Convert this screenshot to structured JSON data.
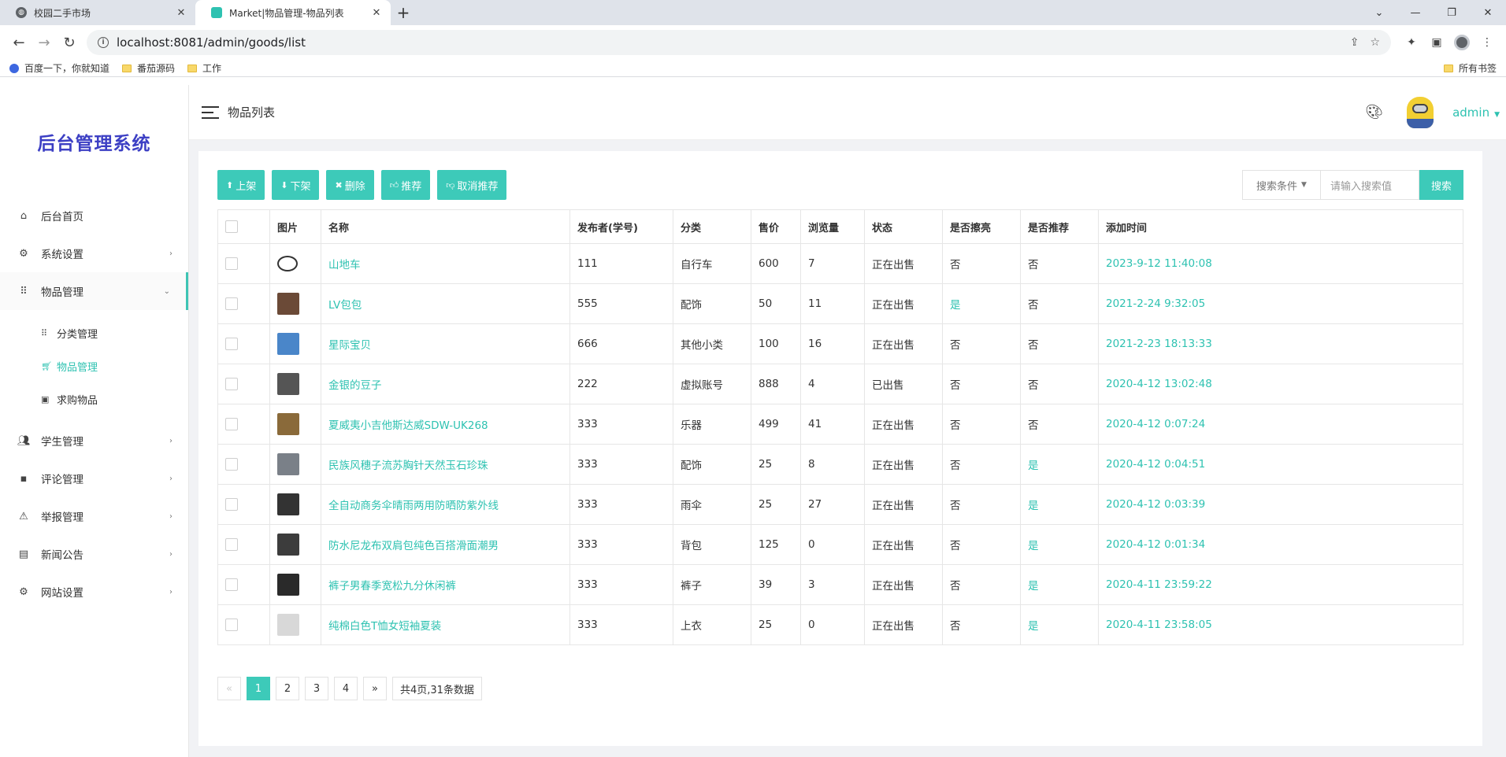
{
  "browser": {
    "tabs": [
      {
        "title": "校园二手市场",
        "active": false
      },
      {
        "title": "Market|物品管理-物品列表",
        "active": true
      }
    ],
    "url": "localhost:8081/admin/goods/list",
    "bookmarks": [
      "百度一下，你就知道",
      "番茄源码",
      "工作"
    ],
    "bookmarks_right": "所有书签"
  },
  "app": {
    "logo": "后台管理系统",
    "breadcrumb": "物品列表",
    "user": "admin",
    "accent": "#3dcab9"
  },
  "menu": [
    {
      "label": "后台首页",
      "icon": "home-icon",
      "arrow": ""
    },
    {
      "label": "系统设置",
      "icon": "gear-icon",
      "arrow": "›"
    },
    {
      "label": "物品管理",
      "icon": "grid-icon",
      "arrow": "⌄"
    },
    {
      "label": "学生管理",
      "icon": "people-icon",
      "arrow": "›"
    },
    {
      "label": "评论管理",
      "icon": "comment-icon",
      "arrow": "›"
    },
    {
      "label": "举报管理",
      "icon": "warning-icon",
      "arrow": "›"
    },
    {
      "label": "新闻公告",
      "icon": "news-icon",
      "arrow": "›"
    },
    {
      "label": "网站设置",
      "icon": "gear-icon",
      "arrow": "›"
    }
  ],
  "submenu": [
    {
      "label": "分类管理",
      "icon": "grid-small-icon"
    },
    {
      "label": "物品管理",
      "icon": "cart-icon"
    },
    {
      "label": "求购物品",
      "icon": "ticket-icon"
    }
  ],
  "toolbar": {
    "buttons": [
      "上架",
      "下架",
      "删除",
      "推荐",
      "取消推荐"
    ],
    "search_select": "搜索条件",
    "search_placeholder": "请输入搜索值",
    "search_button": "搜索"
  },
  "table": {
    "headers": [
      "图片",
      "名称",
      "发布者(学号)",
      "分类",
      "售价",
      "浏览量",
      "状态",
      "是否擦亮",
      "是否推荐",
      "添加时间"
    ],
    "rows": [
      {
        "name": "山地车",
        "publisher": "111",
        "category": "自行车",
        "price": "600",
        "views": "7",
        "status": "正在出售",
        "polished": "否",
        "recommended": "否",
        "time": "2023-9-12 11:40:08",
        "thumb": "#ffffff"
      },
      {
        "name": "LV包包",
        "publisher": "555",
        "category": "配饰",
        "price": "50",
        "views": "11",
        "status": "正在出售",
        "polished": "是",
        "recommended": "否",
        "time": "2021-2-24 9:32:05",
        "thumb": "#6b4a37"
      },
      {
        "name": "星际宝贝",
        "publisher": "666",
        "category": "其他小类",
        "price": "100",
        "views": "16",
        "status": "正在出售",
        "polished": "否",
        "recommended": "否",
        "time": "2021-2-23 18:13:33",
        "thumb": "#4a86c9"
      },
      {
        "name": "金银的豆子",
        "publisher": "222",
        "category": "虚拟账号",
        "price": "888",
        "views": "4",
        "status": "已出售",
        "polished": "否",
        "recommended": "否",
        "time": "2020-4-12 13:02:48",
        "thumb": "#555555"
      },
      {
        "name": "夏威夷小吉他斯达威SDW-UK268",
        "publisher": "333",
        "category": "乐器",
        "price": "499",
        "views": "41",
        "status": "正在出售",
        "polished": "否",
        "recommended": "否",
        "time": "2020-4-12 0:07:24",
        "thumb": "#8a6a3a"
      },
      {
        "name": "民族风穗子流苏胸针天然玉石珍珠",
        "publisher": "333",
        "category": "配饰",
        "price": "25",
        "views": "8",
        "status": "正在出售",
        "polished": "否",
        "recommended": "是",
        "time": "2020-4-12 0:04:51",
        "thumb": "#7a8088"
      },
      {
        "name": "全自动商务伞晴雨两用防晒防紫外线",
        "publisher": "333",
        "category": "雨伞",
        "price": "25",
        "views": "27",
        "status": "正在出售",
        "polished": "否",
        "recommended": "是",
        "time": "2020-4-12 0:03:39",
        "thumb": "#333333"
      },
      {
        "name": "防水尼龙布双肩包纯色百搭滑面潮男",
        "publisher": "333",
        "category": "背包",
        "price": "125",
        "views": "0",
        "status": "正在出售",
        "polished": "否",
        "recommended": "是",
        "time": "2020-4-12 0:01:34",
        "thumb": "#3c3c3c"
      },
      {
        "name": "裤子男春季宽松九分休闲裤",
        "publisher": "333",
        "category": "裤子",
        "price": "39",
        "views": "3",
        "status": "正在出售",
        "polished": "否",
        "recommended": "是",
        "time": "2020-4-11 23:59:22",
        "thumb": "#2a2a2a"
      },
      {
        "name": "纯棉白色T恤女短袖夏装",
        "publisher": "333",
        "category": "上衣",
        "price": "25",
        "views": "0",
        "status": "正在出售",
        "polished": "否",
        "recommended": "是",
        "time": "2020-4-11 23:58:05",
        "thumb": "#d8d8d8"
      }
    ]
  },
  "pagination": {
    "prev": "«",
    "pages": [
      "1",
      "2",
      "3",
      "4"
    ],
    "current": "1",
    "next": "»",
    "summary": "共4页,31条数据"
  }
}
